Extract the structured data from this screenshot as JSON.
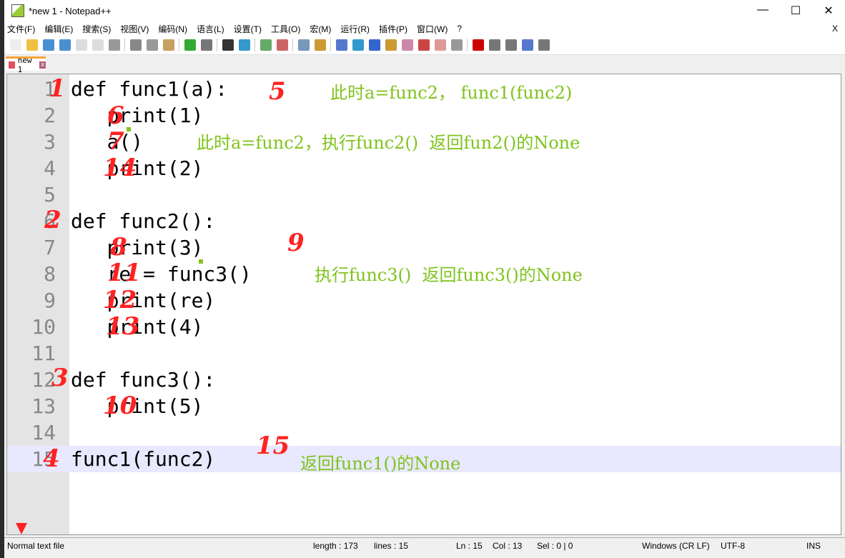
{
  "window": {
    "title": "*new 1 - Notepad++",
    "minimize": "—",
    "maximize": "☐",
    "close": "✕"
  },
  "menu": [
    "文件(F)",
    "编辑(E)",
    "搜索(S)",
    "视图(V)",
    "编码(N)",
    "语言(L)",
    "设置(T)",
    "工具(O)",
    "宏(M)",
    "运行(R)",
    "插件(P)",
    "窗口(W)",
    "?"
  ],
  "menu_close": "X",
  "tab": {
    "label": "new 1",
    "close": "x"
  },
  "code": [
    "def func1(a):",
    "   print(1)",
    "   a()",
    "   print(2)",
    "",
    "def func2():",
    "   print(3)",
    "   re = func3()",
    "   print(re)",
    "   print(4)",
    "",
    "def func3():",
    "   print(5)",
    "",
    "func1(func2)"
  ],
  "line_numbers": [
    "1",
    "2",
    "3",
    "4",
    "5",
    "6",
    "7",
    "8",
    "9",
    "10",
    "11",
    "12",
    "13",
    "14",
    "15"
  ],
  "annotations": {
    "a1": "此时a=func2， func1(func2)",
    "a2": "此时a=func2，执行func2()  返回fun2()的None",
    "a3": "执行func3()  返回func3()的None",
    "a4": "返回func1()的None"
  },
  "red_marks": [
    "1",
    "5",
    "6",
    "7",
    "14",
    "2",
    "8",
    "9",
    "11",
    "12",
    "13",
    "3",
    "10",
    "4",
    "15"
  ],
  "colors": {
    "annotation": "#7fc31c",
    "handwriting": "#ff2222",
    "current_line": "#e8e8ff"
  },
  "status": {
    "type": "Normal text file",
    "length": "length : 173",
    "lines": "lines : 15",
    "ln": "Ln : 15",
    "col": "Col : 13",
    "sel": "Sel : 0 | 0",
    "eol": "Windows (CR LF)",
    "enc": "UTF-8",
    "mode": "INS"
  }
}
